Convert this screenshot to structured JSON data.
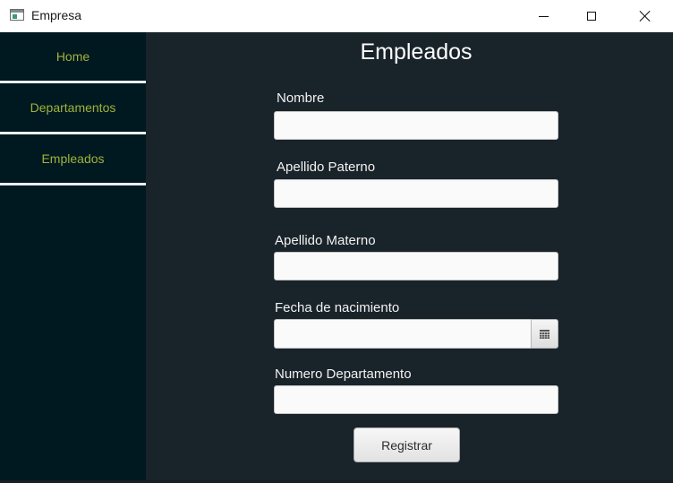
{
  "window": {
    "title": "Empresa",
    "icon": "window-app-icon"
  },
  "sidebar": {
    "items": [
      {
        "label": "Home"
      },
      {
        "label": "Departamentos"
      },
      {
        "label": "Empleados"
      }
    ],
    "item_color": "#9fb33a",
    "background": "#001820"
  },
  "main": {
    "title": "Empleados",
    "background": "#19232a"
  },
  "form": {
    "nombre_label": "Nombre",
    "nombre_value": "",
    "apellido_paterno_label": "Apellido Paterno",
    "apellido_paterno_value": "",
    "apellido_materno_label": "Apellido Materno",
    "apellido_materno_value": "",
    "fecha_label": "Fecha de nacimiento",
    "fecha_value": "",
    "numero_departamento_label": "Numero Departamento",
    "numero_departamento_value": "",
    "submit_label": "Registrar"
  }
}
